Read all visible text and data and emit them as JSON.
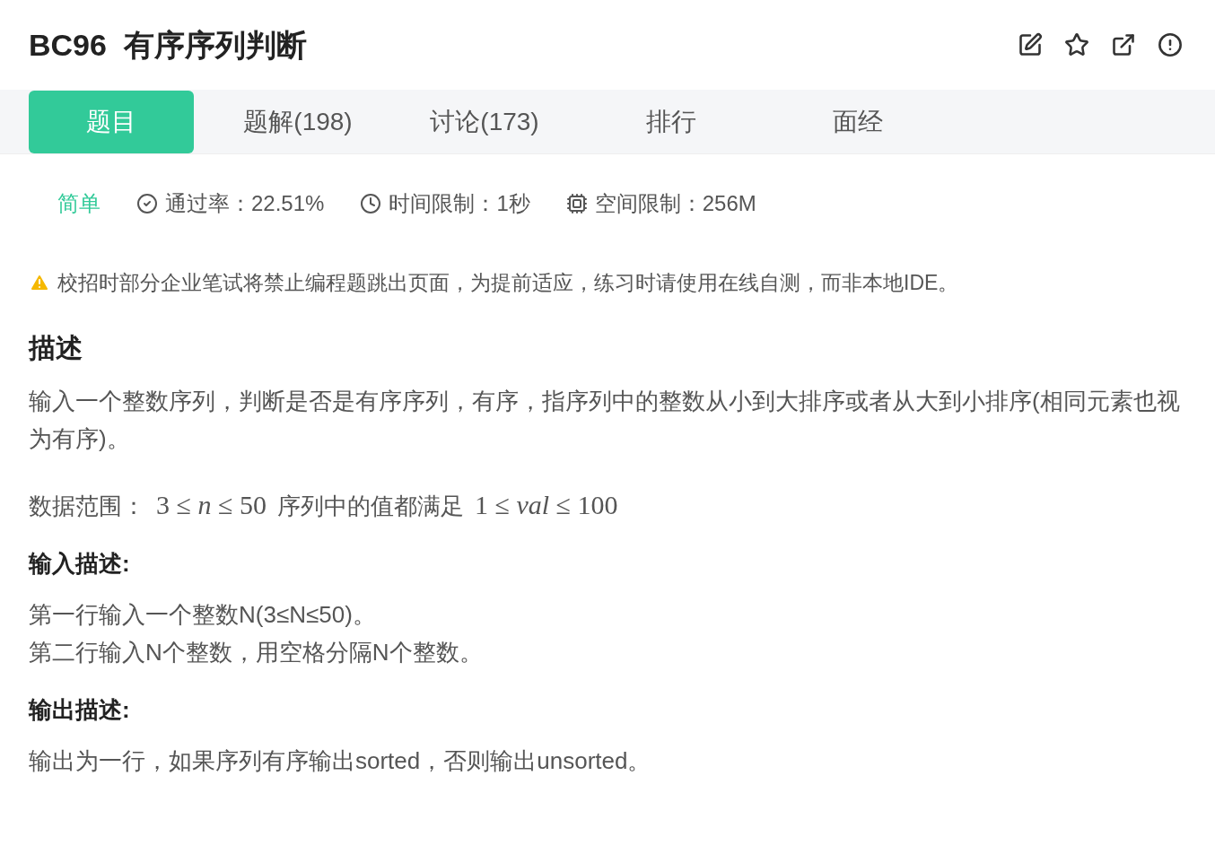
{
  "title": "BC96  有序序列判断",
  "tabs": [
    {
      "label": "题目",
      "selected": true
    },
    {
      "label": "题解(198)",
      "selected": false
    },
    {
      "label": "讨论(173)",
      "selected": false
    },
    {
      "label": "排行",
      "selected": false
    },
    {
      "label": "面经",
      "selected": false
    }
  ],
  "meta": {
    "difficulty": "简单",
    "pass_rate": "通过率：22.51%",
    "time_limit": "时间限制：1秒",
    "memory_limit": "空间限制：256M"
  },
  "warning": "校招时部分企业笔试将禁止编程题跳出页面，为提前适应，练习时请使用在线自测，而非本地IDE。",
  "sections": [
    {
      "heading": "描述",
      "kind": "large",
      "paragraphs": [
        [
          {
            "kind": "text",
            "text": "输入一个整数序列，判断是否是有序序列，有序，指序列中的整数从小到大排序或者从大到小排序(相同元素也视为有序)。"
          }
        ],
        [
          {
            "kind": "text",
            "text": "数据范围："
          },
          {
            "kind": "math",
            "text": "3 ≤ *n* ≤ 50"
          },
          {
            "kind": "text",
            "text": "序列中的值都满足"
          },
          {
            "kind": "math",
            "text": "1 ≤ *val* ≤ 100"
          }
        ]
      ]
    },
    {
      "heading": "输入描述:",
      "kind": "small",
      "paragraphs": [
        [
          {
            "kind": "text",
            "text": "第一行输入一个整数N(3≤N≤50)。"
          }
        ],
        [
          {
            "kind": "text",
            "text": "第二行输入N个整数，用空格分隔N个整数。"
          }
        ]
      ]
    },
    {
      "heading": "输出描述:",
      "kind": "small",
      "paragraphs": [
        [
          {
            "kind": "text",
            "text": "输出为一行，如果序列有序输出sorted，否则输出unsorted。"
          }
        ]
      ]
    }
  ]
}
